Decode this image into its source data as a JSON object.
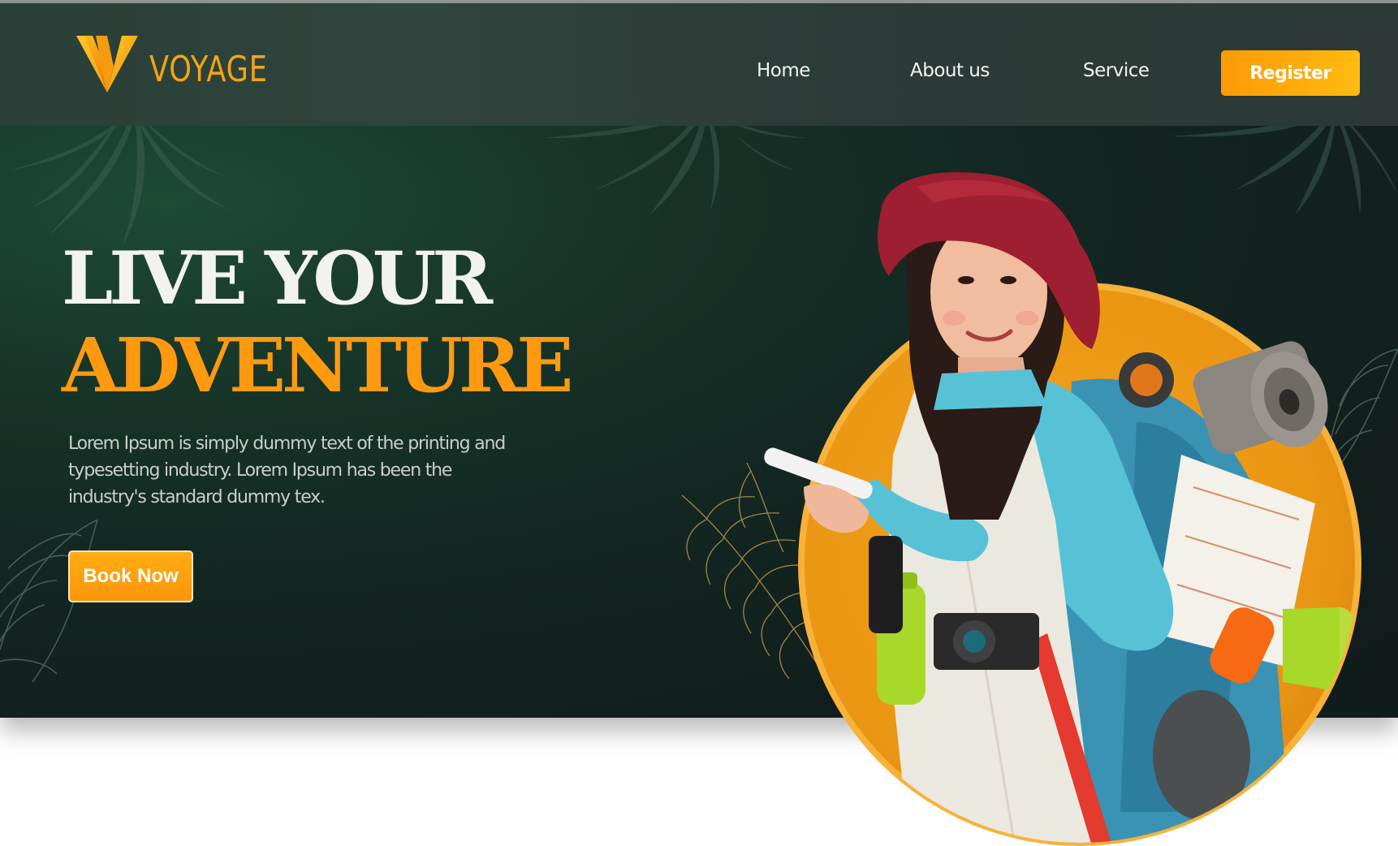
{
  "brand": {
    "name": "VOYAGE",
    "logo_icon": "v-logo-icon"
  },
  "nav": {
    "items": [
      {
        "label": "Home"
      },
      {
        "label": "About us"
      },
      {
        "label": "Service"
      }
    ],
    "register_label": "Register"
  },
  "hero": {
    "headline_line1": "LIVE YOUR",
    "headline_line2": "ADVENTURE",
    "description": "Lorem Ipsum is simply dummy text of the printing and typesetting industry. Lorem Ipsum has been the industry's standard dummy tex.",
    "cta_label": "Book Now",
    "image": "traveler-with-backpack-illustration"
  },
  "colors": {
    "accent": "#ff9a10",
    "accent_light": "#ffbb10",
    "background_dark": "#111e1d",
    "navbar": "#2c3d37",
    "circle": "#f0a020"
  }
}
